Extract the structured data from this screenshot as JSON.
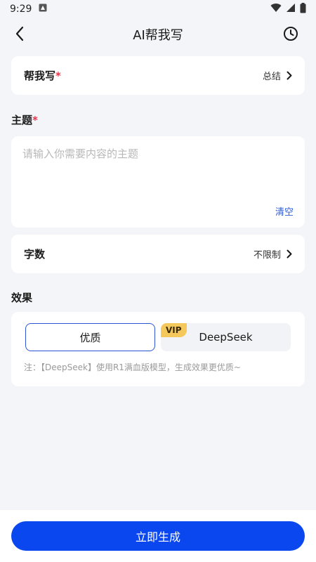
{
  "status_bar": {
    "time": "9:29"
  },
  "header": {
    "title": "AI帮我写"
  },
  "help_write": {
    "label": "帮我写",
    "required_mark": "*",
    "value": "总结"
  },
  "topic": {
    "label": "主题",
    "required_mark": "*",
    "placeholder": "请输入你需要内容的主题",
    "clear_label": "清空"
  },
  "word_count": {
    "label": "字数",
    "value": "不限制"
  },
  "effect": {
    "label": "效果",
    "options": [
      {
        "label": "优质",
        "selected": true
      },
      {
        "label": "DeepSeek",
        "badge": "VIP",
        "selected": false
      }
    ],
    "note": "注：【DeepSeek】使用R1满血版模型，生成效果更优质~"
  },
  "submit": {
    "label": "立即生成"
  },
  "colors": {
    "accent": "#0a47ef",
    "required": "#e8344a",
    "link": "#2a5bd7",
    "vip": "#f5c85b"
  }
}
